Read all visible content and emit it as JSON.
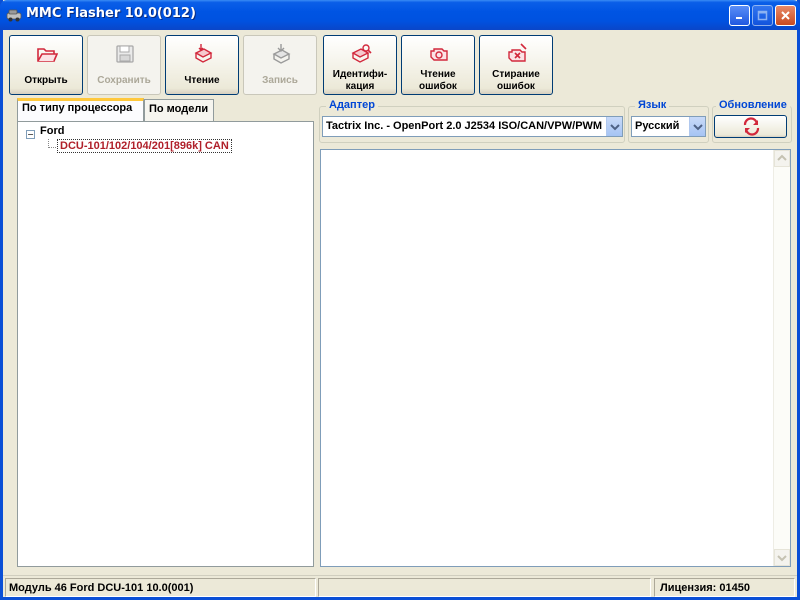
{
  "window": {
    "title": "MMC Flasher 10.0(012)"
  },
  "toolbar": {
    "open": [
      "Открыть"
    ],
    "save": [
      "Сохранить"
    ],
    "read": [
      "Чтение"
    ],
    "write": [
      "Запись"
    ],
    "identify": [
      "Идентифи-",
      "кация"
    ],
    "read_errors": [
      "Чтение",
      "ошибок"
    ],
    "clear_errors": [
      "Стирание",
      "ошибок"
    ]
  },
  "tabs": {
    "by_processor": "По типу процессора",
    "by_model": "По модели"
  },
  "tree": {
    "root_label": "Ford",
    "child_label": "DCU-101/102/104/201[896k] CAN"
  },
  "adapter": {
    "title": "Адаптер",
    "value": "Tactrix Inc. - OpenPort 2.0 J2534 ISO/CAN/VPW/PWM"
  },
  "language": {
    "title": "Язык",
    "value": "Русский"
  },
  "update": {
    "title": "Обновление"
  },
  "status": {
    "module": "Модуль 46 Ford DCU-101 10.0(001)",
    "middle": "",
    "license": "Лицензия: 01450"
  },
  "colors": {
    "titlebar": "#0054e3",
    "group_title": "#0046d5",
    "tree_child": "#b0202a",
    "tool_icon_red": "#d2283c"
  }
}
